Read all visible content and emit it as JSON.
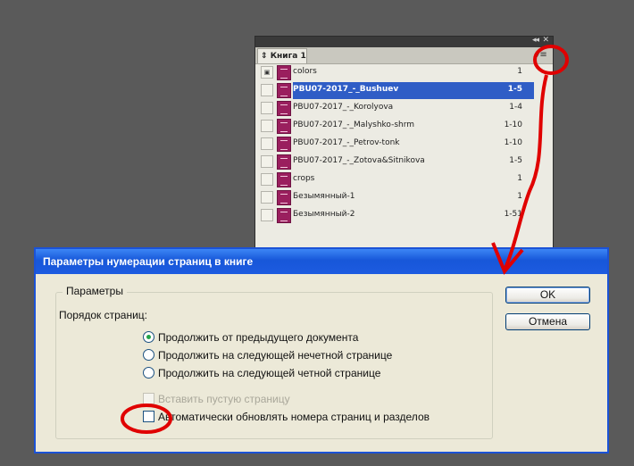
{
  "book_panel": {
    "tab_label": "Книга 1",
    "menu_icon": "panel-menu-icon",
    "rows": [
      {
        "name": "colors",
        "pages": "1",
        "master": true,
        "selected": false
      },
      {
        "name": "PBU07-2017_-_Bushuev",
        "pages": "1-5",
        "master": false,
        "selected": true
      },
      {
        "name": "PBU07-2017_-_Korolyova",
        "pages": "1-4",
        "master": false,
        "selected": false
      },
      {
        "name": "PBU07-2017_-_Malyshko-shrm",
        "pages": "1-10",
        "master": false,
        "selected": false
      },
      {
        "name": "PBU07-2017_-_Petrov-tonk",
        "pages": "1-10",
        "master": false,
        "selected": false
      },
      {
        "name": "PBU07-2017_-_Zotova&Sitnikova",
        "pages": "1-5",
        "master": false,
        "selected": false
      },
      {
        "name": "crops",
        "pages": "1",
        "master": false,
        "selected": false
      },
      {
        "name": "Безымянный-1",
        "pages": "1",
        "master": false,
        "selected": false
      },
      {
        "name": "Безымянный-2",
        "pages": "1-51",
        "master": false,
        "selected": false
      }
    ]
  },
  "dialog": {
    "title": "Параметры нумерации страниц в книге",
    "group_label": "Параметры",
    "order_label": "Порядок страниц:",
    "radios": [
      {
        "label": "Продолжить от предыдущего документа",
        "checked": true
      },
      {
        "label": "Продолжить на следующей нечетной странице",
        "checked": false
      },
      {
        "label": "Продолжить на следующей четной странице",
        "checked": false
      }
    ],
    "insert_blank_label": "Вставить пустую страницу",
    "auto_update_label": "Автоматически обновлять номера страниц и разделов",
    "ok_label": "OK",
    "cancel_label": "Отмена"
  },
  "colors": {
    "annotation": "#e00000",
    "selection": "#2f5dc6",
    "title_bar": "#1d5be0"
  }
}
